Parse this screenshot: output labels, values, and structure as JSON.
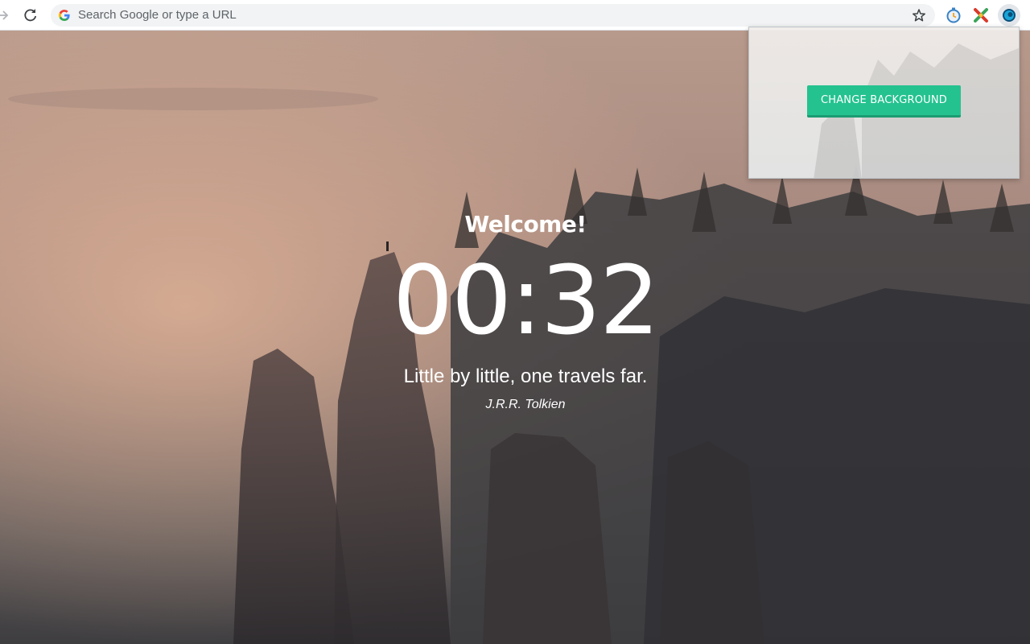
{
  "browser": {
    "omnibox": {
      "placeholder": "Search Google or type a URL",
      "value": ""
    },
    "icons": [
      "forward-arrow-icon",
      "reload-icon",
      "google-logo-icon",
      "star-icon",
      "timer-extension-icon",
      "puzzle-extension-icon",
      "blue-circle-extension-icon"
    ]
  },
  "newtab": {
    "welcome": "Welcome!",
    "clock": "00:32",
    "quote": "Little by little, one travels far.",
    "author": "J.R.R. Tolkien"
  },
  "popup": {
    "button_label": "CHANGE BACKGROUND"
  },
  "colors": {
    "accent": "#24c28f",
    "omnibox_bg": "#f1f3f4"
  }
}
